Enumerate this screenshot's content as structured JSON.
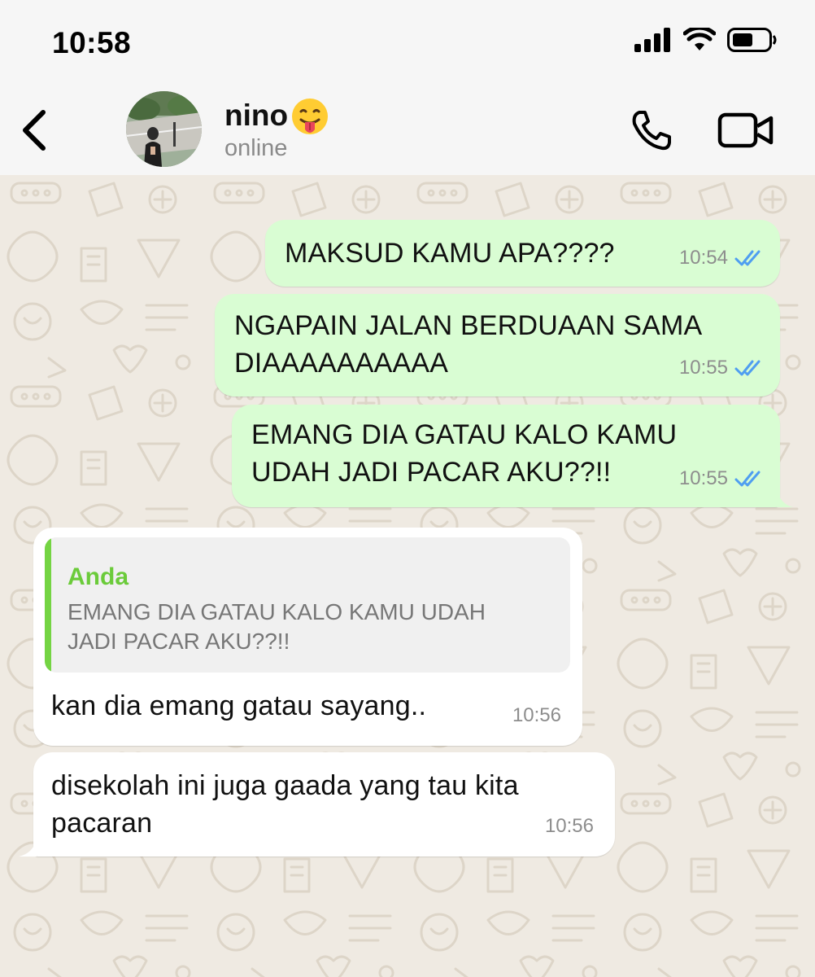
{
  "status_bar": {
    "time": "10:58"
  },
  "header": {
    "contact_name": "nino",
    "contact_emoji": "😛",
    "contact_status": "online"
  },
  "messages": [
    {
      "direction": "out",
      "text": "MAKSUD KAMU APA????",
      "time": "10:54",
      "read_receipt": "double-check-icon"
    },
    {
      "direction": "out",
      "text": "NGAPAIN JALAN BERDUAAN SAMA\nDIAAAAAAAAAA",
      "time": "10:55",
      "read_receipt": "double-check-icon"
    },
    {
      "direction": "out",
      "text": "EMANG DIA GATAU KALO KAMU\nUDAH JADI PACAR AKU??!!",
      "time": "10:55",
      "read_receipt": "double-check-icon"
    },
    {
      "direction": "in",
      "quote": {
        "author": "Anda",
        "text": "EMANG DIA GATAU KALO KAMU UDAH\nJADI PACAR AKU??!!"
      },
      "text": "kan dia emang gatau sayang..",
      "time": "10:56"
    },
    {
      "direction": "in",
      "text": "disekolah ini juga gaada yang tau kita\npacaran",
      "time": "10:56"
    }
  ],
  "colors": {
    "outgoing_bubble": "#d9fdd3",
    "incoming_bubble": "#ffffff",
    "read_tick": "#4f9ef0",
    "quote_accent": "#74d443",
    "wallpaper": "#efeae2"
  }
}
